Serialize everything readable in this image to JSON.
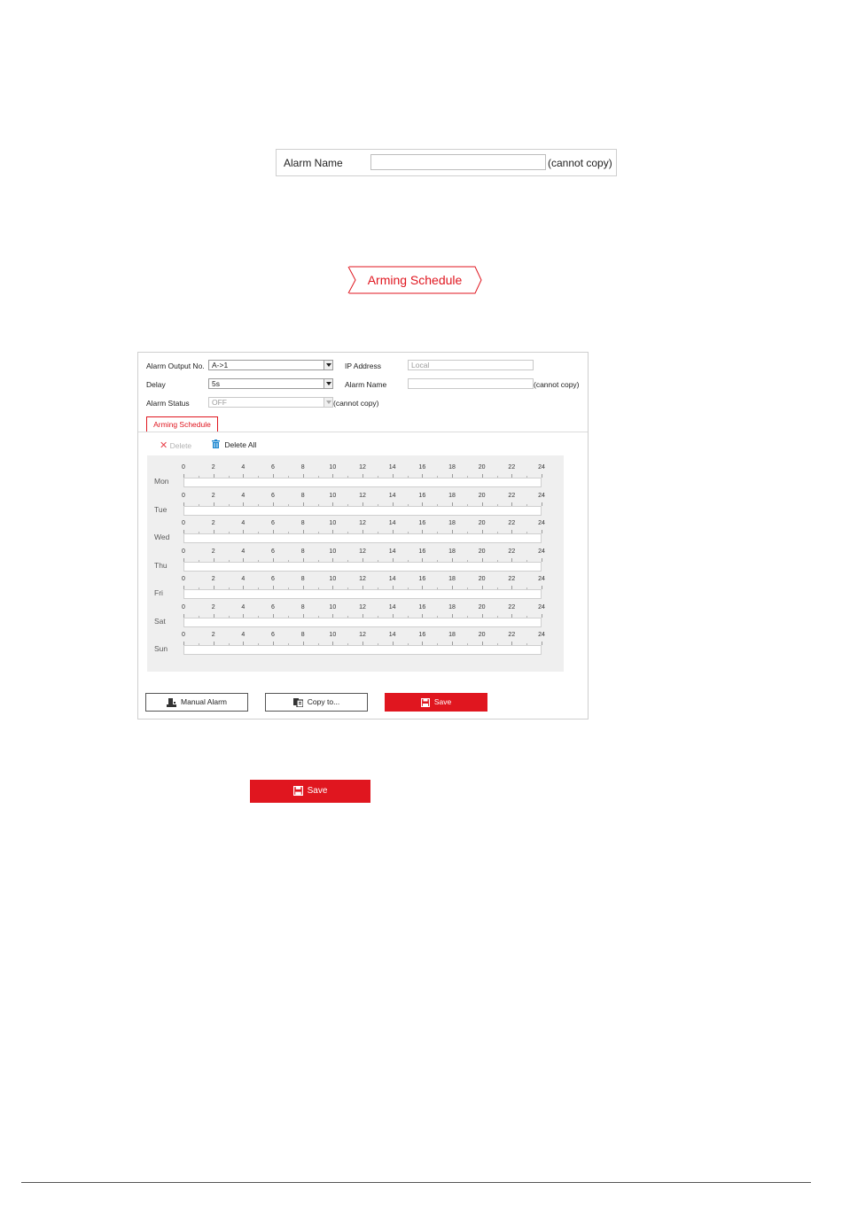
{
  "alarm_name_snippet": {
    "label": "Alarm Name",
    "value": "",
    "note": "(cannot copy)"
  },
  "arming_schedule_button": {
    "label": "Arming Schedule"
  },
  "panel": {
    "alarm_output_label": "Alarm Output No.",
    "alarm_output_value": "A->1",
    "ip_address_label": "IP Address",
    "ip_address_placeholder": "Local",
    "delay_label": "Delay",
    "delay_value": "5s",
    "alarm_name_label": "Alarm Name",
    "alarm_name_value": "",
    "alarm_name_note": "(cannot copy)",
    "alarm_status_label": "Alarm Status",
    "alarm_status_value": "OFF",
    "alarm_status_note": "(cannot copy)",
    "tab_label": "Arming Schedule",
    "delete_label": "Delete",
    "delete_all_label": "Delete All",
    "schedule": {
      "days": [
        "Mon",
        "Tue",
        "Wed",
        "Thu",
        "Fri",
        "Sat",
        "Sun"
      ],
      "hours": [
        "0",
        "2",
        "4",
        "6",
        "8",
        "10",
        "12",
        "14",
        "16",
        "18",
        "20",
        "22",
        "24"
      ]
    },
    "buttons": {
      "manual_alarm": "Manual Alarm",
      "copy_to": "Copy to...",
      "save": "Save"
    }
  },
  "standalone_save": {
    "label": "Save"
  },
  "icons": {
    "delete": "x-icon",
    "delete_all": "trash-icon",
    "manual_alarm": "alarm-icon",
    "copy_to": "copy-icon",
    "save": "save-icon"
  },
  "colors": {
    "accent": "#e0161f",
    "trash": "#1e88d0"
  }
}
